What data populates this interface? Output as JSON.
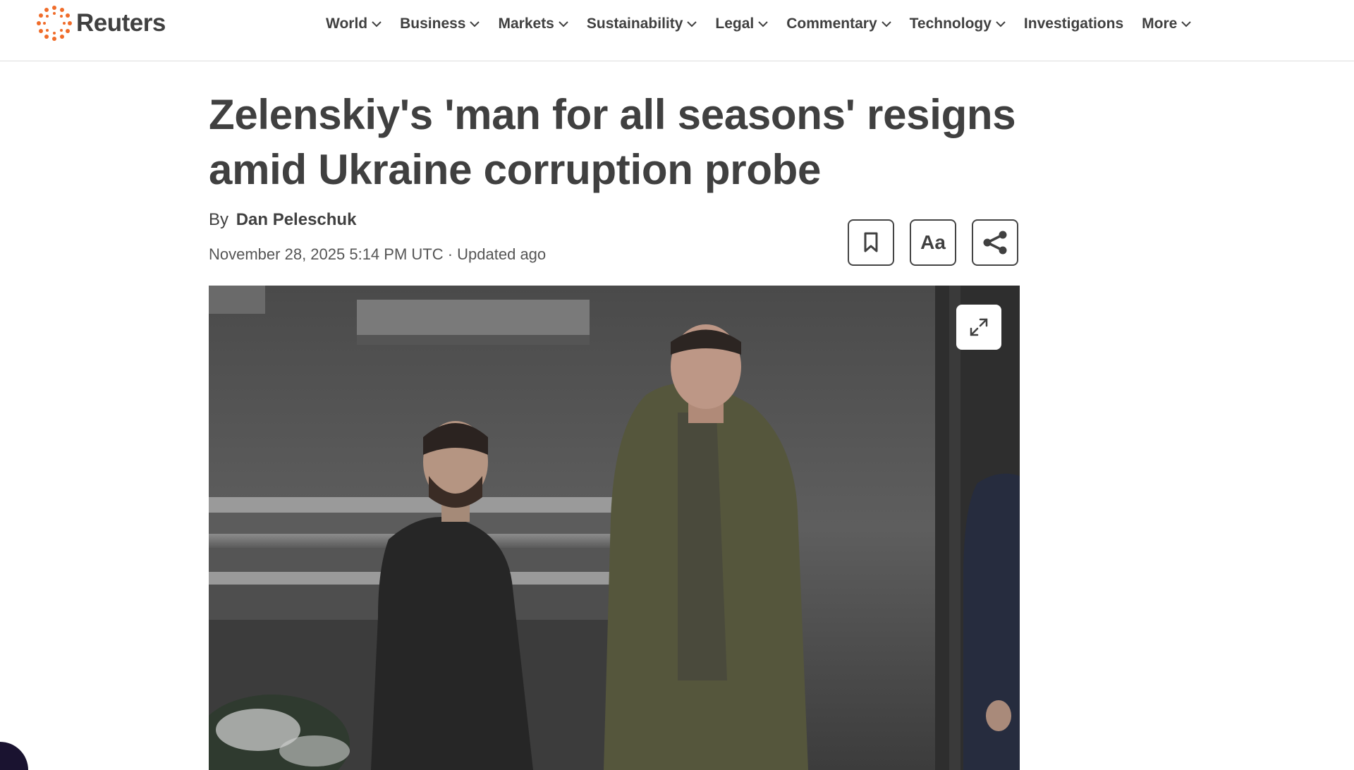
{
  "site": {
    "logo_text": "Reuters",
    "brand_color": "#f06c2a"
  },
  "nav": {
    "items": [
      {
        "label": "World",
        "has_dropdown": true
      },
      {
        "label": "Business",
        "has_dropdown": true
      },
      {
        "label": "Markets",
        "has_dropdown": true
      },
      {
        "label": "Sustainability",
        "has_dropdown": true
      },
      {
        "label": "Legal",
        "has_dropdown": true
      },
      {
        "label": "Commentary",
        "has_dropdown": true
      },
      {
        "label": "Technology",
        "has_dropdown": true
      },
      {
        "label": "Investigations",
        "has_dropdown": false
      },
      {
        "label": "More",
        "has_dropdown": true
      }
    ]
  },
  "article": {
    "headline": "Zelenskiy's 'man for all seasons' resigns amid Ukraine corruption probe",
    "byline_prefix": "By",
    "author": "Dan Peleschuk",
    "dateline": "November 28, 2025 5:14 PM UTC · Updated ago"
  },
  "tools": {
    "bookmark_icon": "bookmark-icon",
    "text_size_label": "Aa",
    "share_icon": "share-icon"
  },
  "hero": {
    "expand_icon": "expand-icon"
  }
}
